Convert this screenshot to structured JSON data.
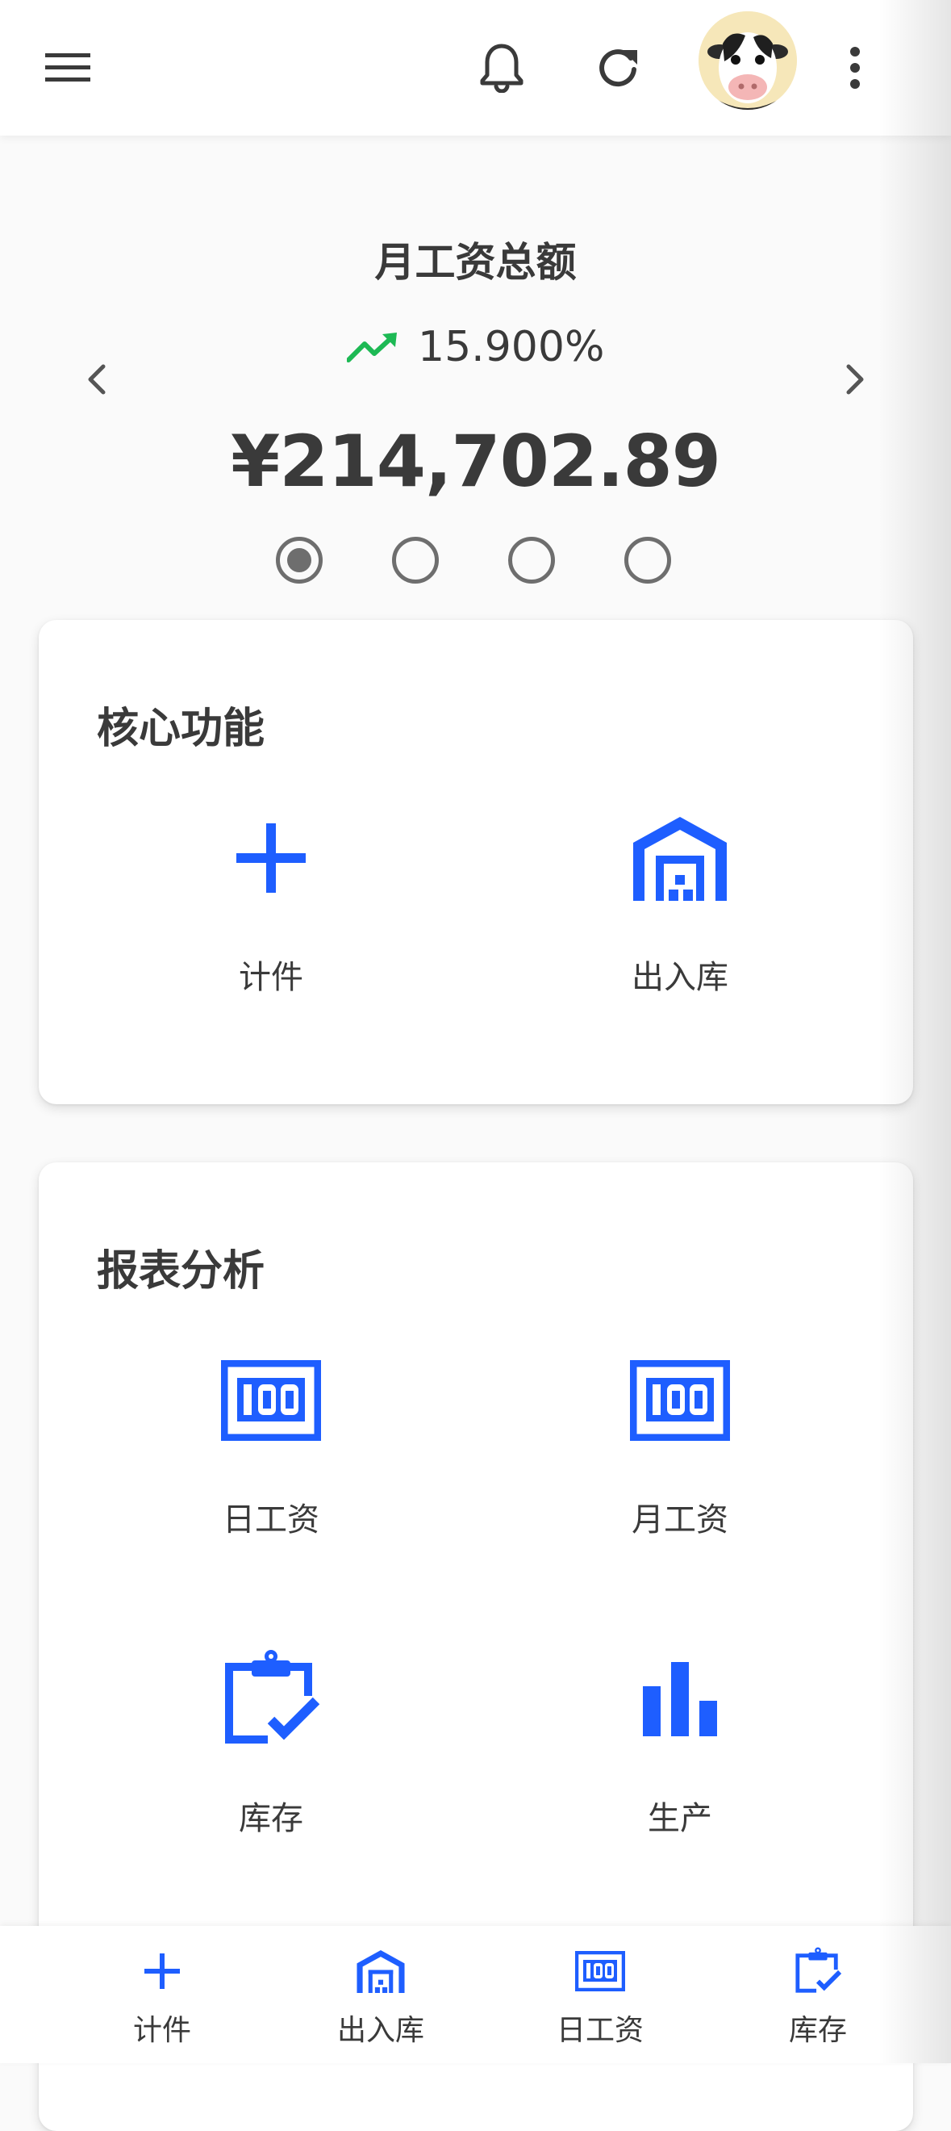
{
  "header": {
    "menu_icon": "menu-icon",
    "bell_icon": "bell-icon",
    "refresh_icon": "refresh-icon",
    "avatar": "cow-avatar",
    "more_icon": "more-vert-icon"
  },
  "summary": {
    "title": "月工资总额",
    "trend_icon": "trending-up-icon",
    "trend_color": "#1db954",
    "trend_value": "15.900%",
    "amount": "¥214,702.89",
    "page_count": 4,
    "active_page": 1
  },
  "core": {
    "title": "核心功能",
    "items": [
      {
        "label": "计件",
        "icon": "plus-icon"
      },
      {
        "label": "出入库",
        "icon": "warehouse-icon"
      }
    ]
  },
  "reports": {
    "title": "报表分析",
    "items": [
      {
        "label": "日工资",
        "icon": "counter-100-icon"
      },
      {
        "label": "月工资",
        "icon": "counter-100-icon"
      },
      {
        "label": "库存",
        "icon": "clipboard-check-icon"
      },
      {
        "label": "生产",
        "icon": "bar-chart-icon"
      }
    ]
  },
  "bottom_nav": {
    "items": [
      {
        "label": "计件",
        "icon": "plus-icon"
      },
      {
        "label": "出入库",
        "icon": "warehouse-icon"
      },
      {
        "label": "日工资",
        "icon": "counter-100-icon"
      },
      {
        "label": "库存",
        "icon": "clipboard-check-icon"
      }
    ]
  },
  "colors": {
    "accent": "#1e5eff",
    "text": "#3a3a3a",
    "trend_up": "#1db954"
  }
}
